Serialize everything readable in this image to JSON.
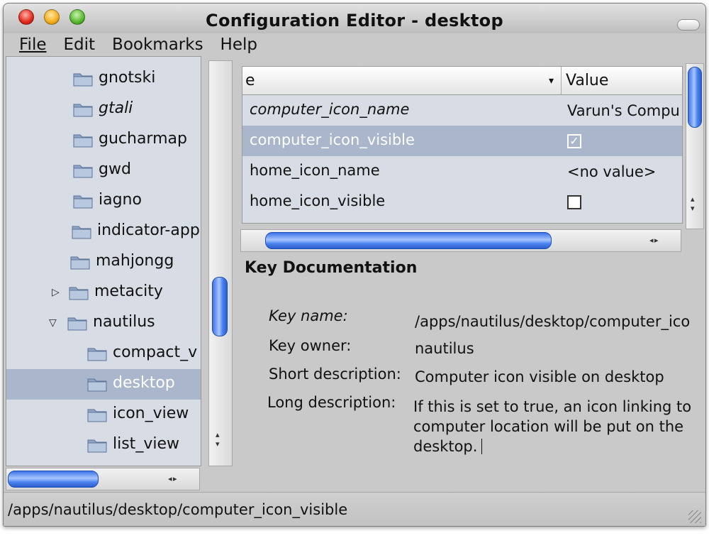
{
  "window": {
    "title": "Configuration Editor - desktop"
  },
  "menu": [
    {
      "label": "File"
    },
    {
      "label": "Edit"
    },
    {
      "label": "Bookmarks"
    },
    {
      "label": "Help"
    }
  ],
  "tree": {
    "items": [
      {
        "label": "gnotski",
        "italic": false,
        "expander": "",
        "selected": false
      },
      {
        "label": "gtali",
        "italic": true,
        "expander": "",
        "selected": false
      },
      {
        "label": "gucharmap",
        "italic": false,
        "expander": "",
        "selected": false
      },
      {
        "label": "gwd",
        "italic": false,
        "expander": "",
        "selected": false
      },
      {
        "label": "iagno",
        "italic": false,
        "expander": "",
        "selected": false
      },
      {
        "label": "indicator-appl",
        "italic": false,
        "expander": "",
        "selected": false
      },
      {
        "label": "mahjongg",
        "italic": false,
        "expander": "",
        "selected": false
      },
      {
        "label": "metacity",
        "italic": false,
        "expander": "▷",
        "selected": false
      },
      {
        "label": "nautilus",
        "italic": false,
        "expander": "▽",
        "selected": false
      },
      {
        "label": "compact_v",
        "italic": false,
        "expander": "",
        "selected": false
      },
      {
        "label": "desktop",
        "italic": false,
        "expander": "",
        "selected": true
      },
      {
        "label": "icon_view",
        "italic": false,
        "expander": "",
        "selected": false
      },
      {
        "label": "list_view",
        "italic": false,
        "expander": "",
        "selected": false
      }
    ]
  },
  "table": {
    "headers": {
      "name": "e",
      "value": "Value",
      "sort_icon": "▾"
    },
    "rows": [
      {
        "name": "computer_icon_name",
        "italic": true,
        "value": "Varun's Compu",
        "checkbox": null,
        "selected": false
      },
      {
        "name": "computer_icon_visible",
        "italic": false,
        "value": "",
        "checkbox": true,
        "selected": true
      },
      {
        "name": "home_icon_name",
        "italic": false,
        "value": "<no value>",
        "checkbox": null,
        "selected": false
      },
      {
        "name": "home_icon_visible",
        "italic": false,
        "value": "",
        "checkbox": false,
        "selected": false
      }
    ]
  },
  "doc": {
    "heading": "Key Documentation",
    "key_name_label": "Key name:",
    "key_name_value": "/apps/nautilus/desktop/computer_ico",
    "key_owner_label": "Key owner:",
    "key_owner_value": "nautilus",
    "short_desc_label": "Short description:",
    "short_desc_value": "Computer icon visible on desktop",
    "long_desc_label": "Long description:",
    "long_desc_value": "If this is set to true, an icon linking to computer location will be put on the desktop."
  },
  "status": {
    "path": "/apps/nautilus/desktop/computer_icon_visible"
  },
  "colors": {
    "selection": "#a9b6cb",
    "scroll_thumb": "#3b73e6"
  }
}
